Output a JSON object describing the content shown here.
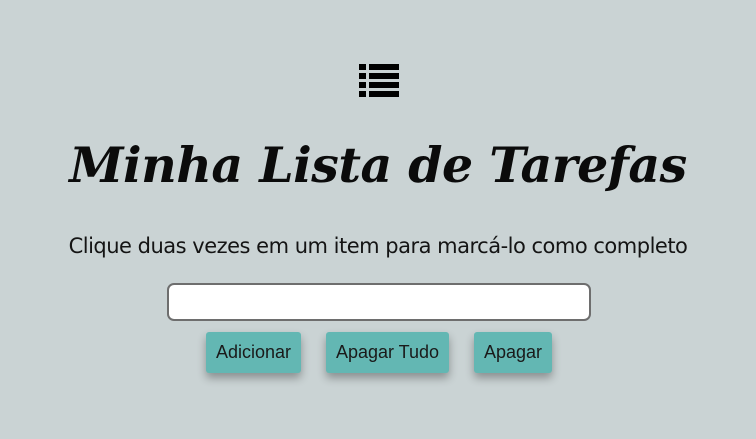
{
  "icons": {
    "header_icon": "list-icon"
  },
  "header": {
    "title": "Minha Lista de Tarefas",
    "subtitle": "Clique duas vezes em um item para marcá-lo como completo"
  },
  "form": {
    "task_input_value": "",
    "task_input_placeholder": ""
  },
  "buttons": {
    "add_label": "Adicionar",
    "clear_all_label": "Apagar Tudo",
    "delete_label": "Apagar"
  },
  "colors": {
    "background": "#cad3d4",
    "button": "#63b7b3"
  }
}
